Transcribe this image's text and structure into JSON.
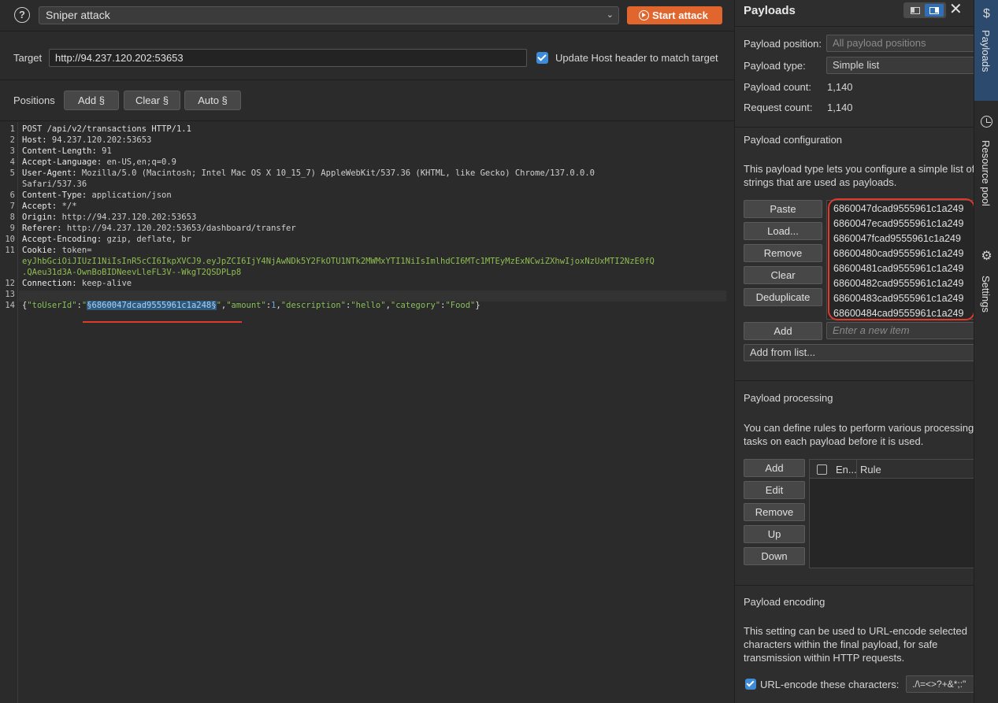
{
  "toolbar": {
    "attack_type": "Sniper attack",
    "start_label": "Start attack"
  },
  "target": {
    "label": "Target",
    "url": "http://94.237.120.202:53653",
    "update_host_label": "Update Host header to match target"
  },
  "positions": {
    "label": "Positions",
    "add_label": "Add §",
    "clear_label": "Clear §",
    "auto_label": "Auto §"
  },
  "request": {
    "line1": "POST /api/v2/transactions HTTP/1.1",
    "host_k": "Host:",
    "host_v": " 94.237.120.202:53653",
    "cl_k": "Content-Length:",
    "cl_v": " 91",
    "al_k": "Accept-Language:",
    "al_v": " en-US,en;q=0.9",
    "ua_k": "User-Agent:",
    "ua_v": " Mozilla/5.0 (Macintosh; Intel Mac OS X 10_15_7) AppleWebKit/537.36 (KHTML, like Gecko) Chrome/137.0.0.0",
    "ua_v2": "Safari/537.36",
    "ct_k": "Content-Type:",
    "ct_v": " application/json",
    "acc_k": "Accept:",
    "acc_v": " */*",
    "or_k": "Origin:",
    "or_v": " http://94.237.120.202:53653",
    "ref_k": "Referer:",
    "ref_v": " http://94.237.120.202:53653/dashboard/transfer",
    "ae_k": "Accept-Encoding:",
    "ae_v": " gzip, deflate, br",
    "ck_k": "Cookie:",
    "ck_v": " token=",
    "token1": "eyJhbGciOiJIUzI1NiIsInR5cCI6IkpXVCJ9.eyJpZCI6IjY4NjAwNDk5Y2FkOTU1NTk2MWMxYTI1NiIsImlhdCI6MTc1MTEyMzExNCwiZXhwIjoxNzUxMTI2NzE0fQ",
    "token2": ".QAeu31d3A-OwnBoBIDNeevLleFL3V--WkgT2QSDPLp8",
    "conn_k": "Connection:",
    "conn_v": " keep-alive",
    "body_p1": "{",
    "body_k1": "\"toUserId\"",
    "body_c1": ":",
    "body_q1": "\"",
    "body_marked": "§6860047dcad9555961c1a248§",
    "body_q2": "\"",
    "body_c2": ",",
    "body_k2": "\"amount\"",
    "body_c3": ":",
    "body_n": "1",
    "body_c4": ",",
    "body_k3": "\"description\"",
    "body_c5": ":",
    "body_v3": "\"hello\"",
    "body_c6": ",",
    "body_k4": "\"category\"",
    "body_c7": ":",
    "body_v4": "\"Food\"",
    "body_p2": "}"
  },
  "line_numbers": [
    "1",
    "2",
    "3",
    "4",
    "5",
    "6",
    "7",
    "8",
    "9",
    "10",
    "11",
    "12",
    "13",
    "14"
  ],
  "payloads_panel": {
    "title": "Payloads",
    "position_label": "Payload position:",
    "position_value": "All payload positions",
    "type_label": "Payload type:",
    "type_value": "Simple list",
    "count_label": "Payload count:",
    "count_value": "1,140",
    "request_label": "Request count:",
    "request_value": "1,140",
    "config_title": "Payload configuration",
    "config_desc": "This payload type lets you configure a simple list of strings that are used as payloads.",
    "buttons": [
      "Paste",
      "Load...",
      "Remove",
      "Clear",
      "Deduplicate"
    ],
    "items": [
      "6860047dcad9555961c1a249",
      "6860047ecad9555961c1a249",
      "6860047fcad9555961c1a249",
      "68600480cad9555961c1a249",
      "68600481cad9555961c1a249",
      "68600482cad9555961c1a249",
      "68600483cad9555961c1a249",
      "68600484cad9555961c1a249"
    ],
    "add_label": "Add",
    "add_placeholder": "Enter a new item",
    "add_from_list": "Add from list...",
    "processing_title": "Payload processing",
    "processing_desc": "You can define rules to perform various processing tasks on each payload before it is used.",
    "processing_buttons": [
      "Add",
      "Edit",
      "Remove",
      "Up",
      "Down"
    ],
    "rule_col_enabled": "En...",
    "rule_col_rule": "Rule",
    "encoding_title": "Payload encoding",
    "encoding_desc": "This setting can be used to URL-encode selected characters within the final payload, for safe transmission within HTTP requests.",
    "urlencode_label": "URL-encode these characters:",
    "urlencode_value": "./\\=<>?+&*;:\""
  },
  "side_tabs": {
    "payloads": "Payloads",
    "resource_pool": "Resource pool",
    "settings": "Settings"
  },
  "colors": {
    "accent": "#e0662e",
    "highlight_outline": "#e03a2a",
    "active_tab": "#2b4a6e"
  }
}
